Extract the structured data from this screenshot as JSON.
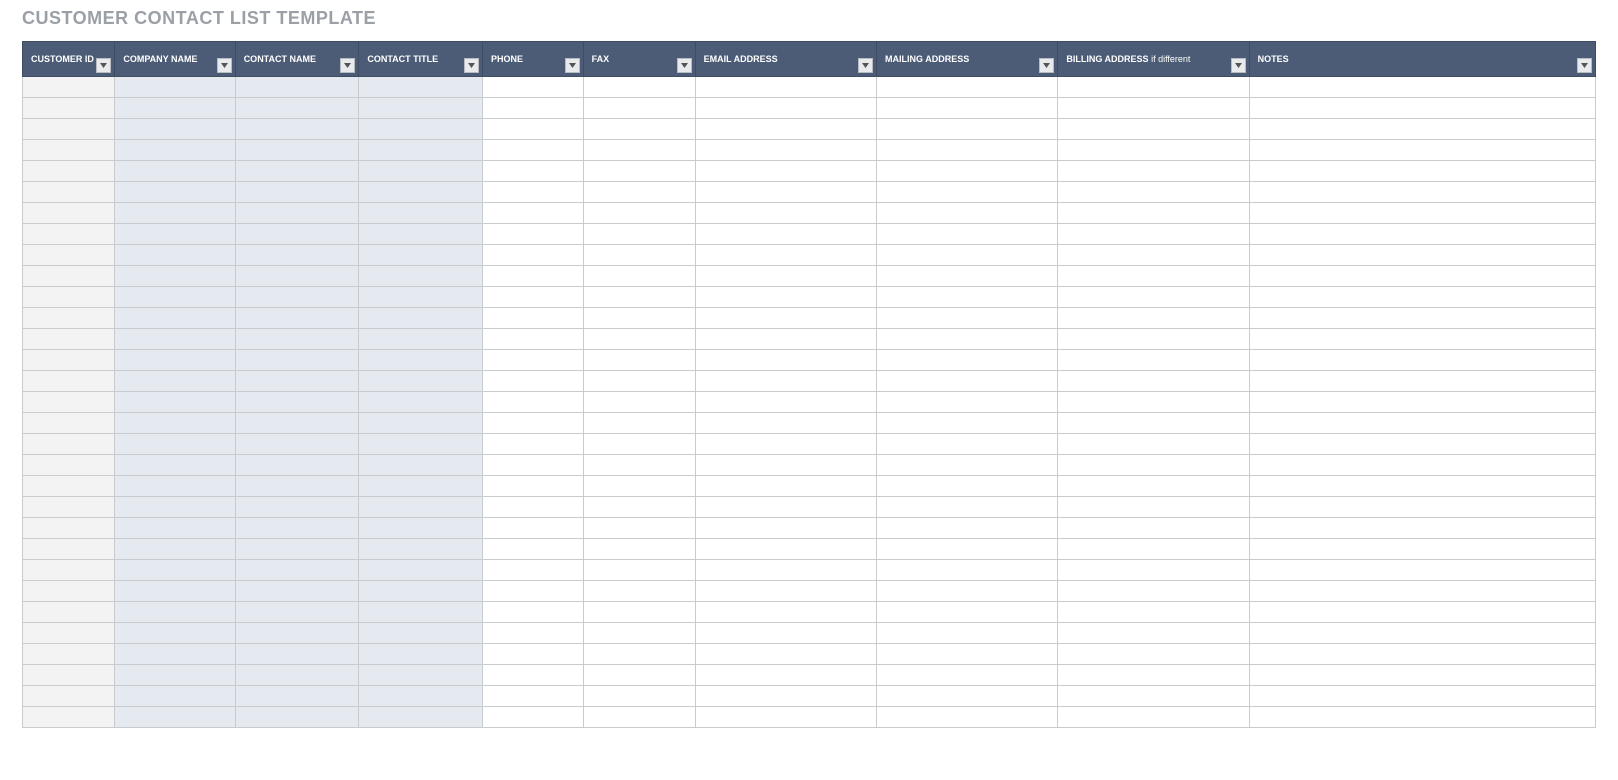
{
  "title": "CUSTOMER CONTACT LIST TEMPLATE",
  "columns": [
    {
      "label": "CUSTOMER ID",
      "sub": "",
      "shade": "a"
    },
    {
      "label": "COMPANY NAME",
      "sub": "",
      "shade": "b"
    },
    {
      "label": "CONTACT NAME",
      "sub": "",
      "shade": "b"
    },
    {
      "label": "CONTACT TITLE",
      "sub": "",
      "shade": "b"
    },
    {
      "label": "PHONE",
      "sub": "",
      "shade": ""
    },
    {
      "label": "FAX",
      "sub": "",
      "shade": ""
    },
    {
      "label": "EMAIL ADDRESS",
      "sub": "",
      "shade": ""
    },
    {
      "label": "MAILING ADDRESS",
      "sub": "",
      "shade": ""
    },
    {
      "label": "BILLING ADDRESS",
      "sub": " if different",
      "shade": ""
    },
    {
      "label": "NOTES",
      "sub": "",
      "shade": ""
    }
  ],
  "row_count": 31
}
